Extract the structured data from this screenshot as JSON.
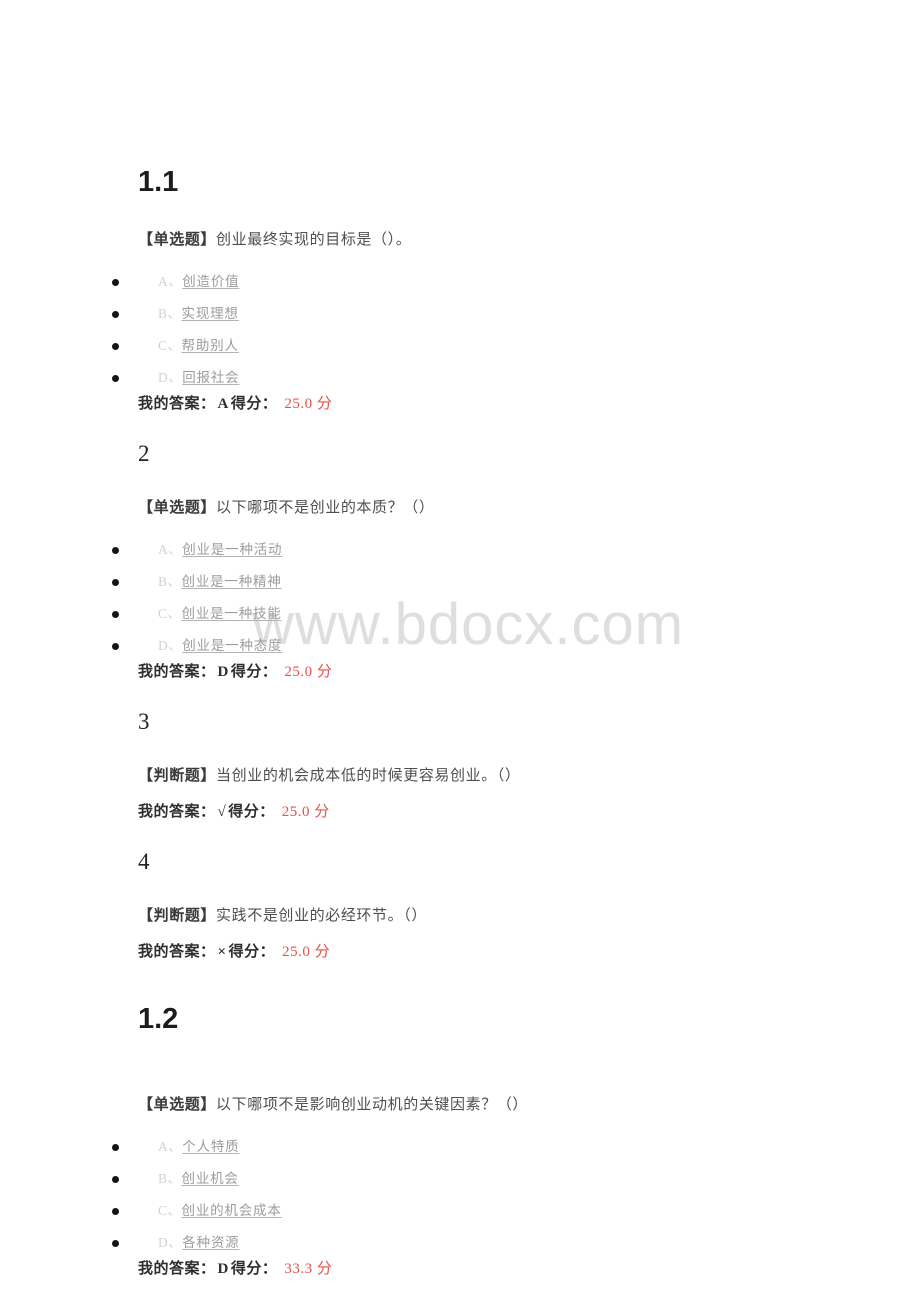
{
  "document": {
    "watermark": "www.bdocx.com",
    "answer_prefix": "我的答案：",
    "score_prefix": "得分：",
    "accent_score_color": "#e8524a",
    "bullet_color": "#141414"
  },
  "sections": [
    {
      "heading": "1.1",
      "heading_style": "section",
      "questions": [
        {
          "number": "",
          "type": "【单选题】",
          "text": "创业最终实现的目标是（）。",
          "options": [
            {
              "label": "A、",
              "text": "创造价值"
            },
            {
              "label": "B、",
              "text": "实现理想"
            },
            {
              "label": "C、",
              "text": "帮助别人"
            },
            {
              "label": "D、",
              "text": "回报社会"
            }
          ],
          "my_answer": "A",
          "score": "25.0 分"
        },
        {
          "number": "2",
          "type": "【单选题】",
          "text": "以下哪项不是创业的本质？（）",
          "options": [
            {
              "label": "A、",
              "text": "创业是一种活动"
            },
            {
              "label": "B、",
              "text": "创业是一种精神"
            },
            {
              "label": "C、",
              "text": "创业是一种技能"
            },
            {
              "label": "D、",
              "text": "创业是一种态度"
            }
          ],
          "my_answer": "D",
          "score": "25.0 分"
        },
        {
          "number": "3",
          "type": "【判断题】",
          "text": "当创业的机会成本低的时候更容易创业。（）",
          "options": [],
          "my_answer": "√",
          "score": "25.0 分"
        },
        {
          "number": "4",
          "type": "【判断题】",
          "text": "实践不是创业的必经环节。（）",
          "options": [],
          "my_answer": "×",
          "score": "25.0 分"
        }
      ]
    },
    {
      "heading": "1.2",
      "heading_style": "section",
      "questions": [
        {
          "number": "",
          "type": "【单选题】",
          "text": "以下哪项不是影响创业动机的关键因素？（）",
          "options": [
            {
              "label": "A、",
              "text": "个人特质"
            },
            {
              "label": "B、",
              "text": "创业机会"
            },
            {
              "label": "C、",
              "text": "创业的机会成本"
            },
            {
              "label": "D、",
              "text": "各种资源"
            }
          ],
          "my_answer": "D",
          "score": "33.3 分"
        }
      ]
    }
  ]
}
